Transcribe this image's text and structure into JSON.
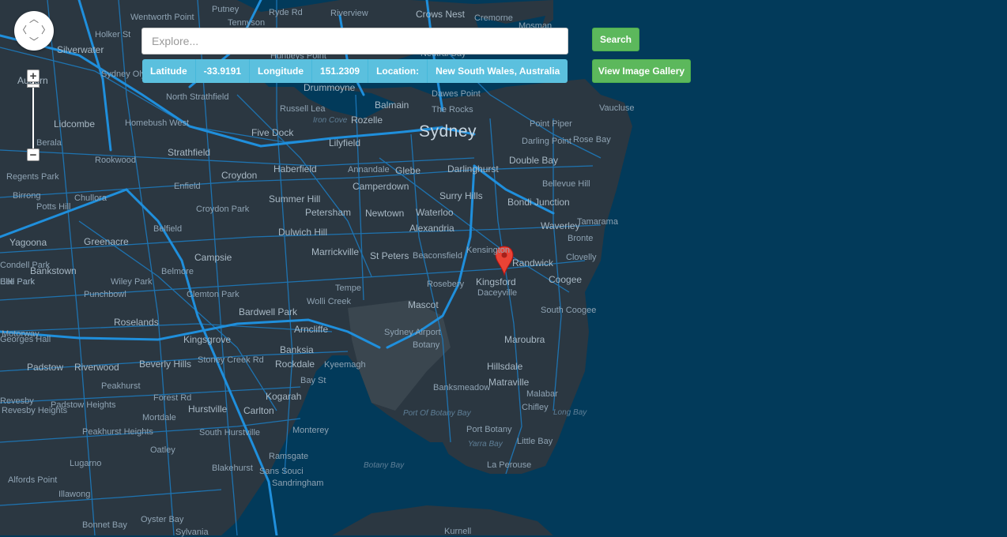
{
  "search": {
    "placeholder": "Explore...",
    "button_label": "Search"
  },
  "gallery_button_label": "View Image Gallery",
  "coordinates": {
    "lat_label": "Latitude",
    "lat_value": "-33.9191",
    "lng_label": "Longitude",
    "lng_value": "151.2309",
    "loc_label": "Location:",
    "loc_value": "New South Wales, Australia"
  },
  "map": {
    "labels": [
      "Wentworth Point",
      "Putney",
      "Ryde Rd",
      "Riverview",
      "Crows Nest",
      "Cremorne",
      "Mosman",
      "Holker St",
      "Silverwater",
      "Tennyson",
      "Huntleys Point",
      "Neutral Bay",
      "Sydney Olympic Park",
      "Auburn",
      "Drummoyne",
      "North Strathfield",
      "Dawes Point",
      "Balmain",
      "Russell Lea",
      "Rozelle",
      "The Rocks",
      "Vaucluse",
      "Lidcombe",
      "Homebush West",
      "Iron Cove",
      "Point Piper",
      "Berala",
      "Five Dock",
      "Sydney",
      "Darling Point",
      "Rose Bay",
      "Lilyfield",
      "Strathfield",
      "Double Bay",
      "Rookwood",
      "Haberfield",
      "Darlinghurst",
      "Regents Park",
      "Annandale",
      "Glebe",
      "Croydon",
      "Bellevue Hill",
      "Enfield",
      "Camperdown",
      "Chullora",
      "Summer Hill",
      "Birrong",
      "Surry Hills",
      "Bondi Junction",
      "Potts Hill",
      "Croydon Park",
      "Newtown",
      "Waterloo",
      "Tamarama",
      "Petersham",
      "Waverley",
      "Belfield",
      "Alexandria",
      "Bronte",
      "Yagoona",
      "Greenacre",
      "Dulwich Hill",
      "Campsie",
      "Kensington",
      "Clovelly",
      "Marrickville",
      "St Peters",
      "Beaconsfield",
      "Randwick",
      "Bankstown",
      "Belmore",
      "Coogee",
      "Kingsford",
      "Wiley Park",
      "Rosebery",
      "Daceyville",
      "Punchbowl",
      "Clemton Park",
      "Tempe",
      "Wolli Creek",
      "Mascot",
      "Bardwell Park",
      "South Coogee",
      "Roselands",
      "Arncliffe",
      "Sydney Airport",
      "Maroubra",
      "Kingsgrove",
      "Botany",
      "Banksia",
      "Padstow",
      "Riverwood",
      "Beverly Hills",
      "Stoney Creek Rd",
      "Rockdale",
      "Kyeemagh",
      "Hillsdale",
      "Peakhurst",
      "Matraville",
      "Banksmeadow",
      "Revesby",
      "Forest Rd",
      "Kogarah",
      "Malabar",
      "Revesby Heights",
      "Padstow Heights",
      "Hurstville",
      "Carlton",
      "Chifley",
      "Long Bay",
      "Mortdale",
      "Port Of Botany Bay",
      "Peakhurst Heights",
      "South Hurstville",
      "Monterey",
      "Port Botany",
      "Little Bay",
      "Oatley",
      "Yarra Bay",
      "Lugarno",
      "Ramsgate",
      "La Perouse",
      "Alfords Point",
      "Blakehurst",
      "Sans Souci",
      "Botany Bay",
      "Illawong",
      "Sandringham",
      "Bonnet Bay",
      "Oyster Bay",
      "Sylvania",
      "Kurnell",
      "Motorway",
      "Bell Park",
      "Georges Hall",
      "Condell Park",
      "Elle Park",
      "Bay St"
    ]
  },
  "colors": {
    "water": "#023a5a",
    "land": "#2a3640",
    "road": "#1f8fdc",
    "search_button": "#5cb85c",
    "info_bar": "#5bc0de",
    "marker": "#ea4335"
  }
}
